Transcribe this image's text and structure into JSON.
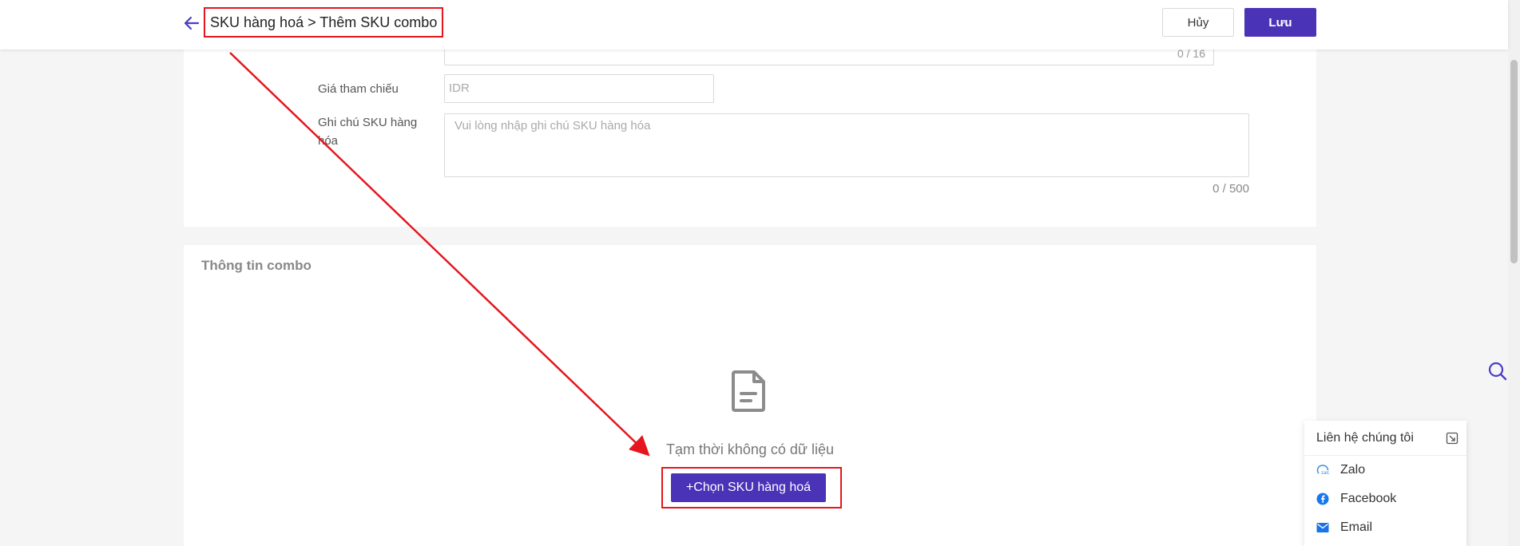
{
  "header": {
    "breadcrumb": "SKU hàng hoá > Thêm SKU combo",
    "cancel_label": "Hủy",
    "save_label": "Lưu"
  },
  "form": {
    "partial_counter": "0 / 16",
    "price_label": "Giá tham chiếu",
    "price_placeholder": "IDR",
    "note_label": "Ghi chú SKU hàng hóa",
    "note_placeholder": "Vui lòng nhập ghi chú SKU hàng hóa",
    "note_counter": "0 / 500"
  },
  "combo": {
    "title": "Thông tin combo",
    "empty_text": "Tạm thời không có dữ liệu",
    "add_button": "+Chọn SKU hàng hoá",
    "icon": "document-icon"
  },
  "contact": {
    "title": "Liên hệ chúng tôi",
    "items": [
      {
        "label": "Zalo",
        "icon": "zalo-icon"
      },
      {
        "label": "Facebook",
        "icon": "facebook-icon"
      },
      {
        "label": "Email",
        "icon": "email-icon"
      }
    ]
  },
  "colors": {
    "accent": "#4b33b8",
    "highlight": "#e5161d"
  }
}
